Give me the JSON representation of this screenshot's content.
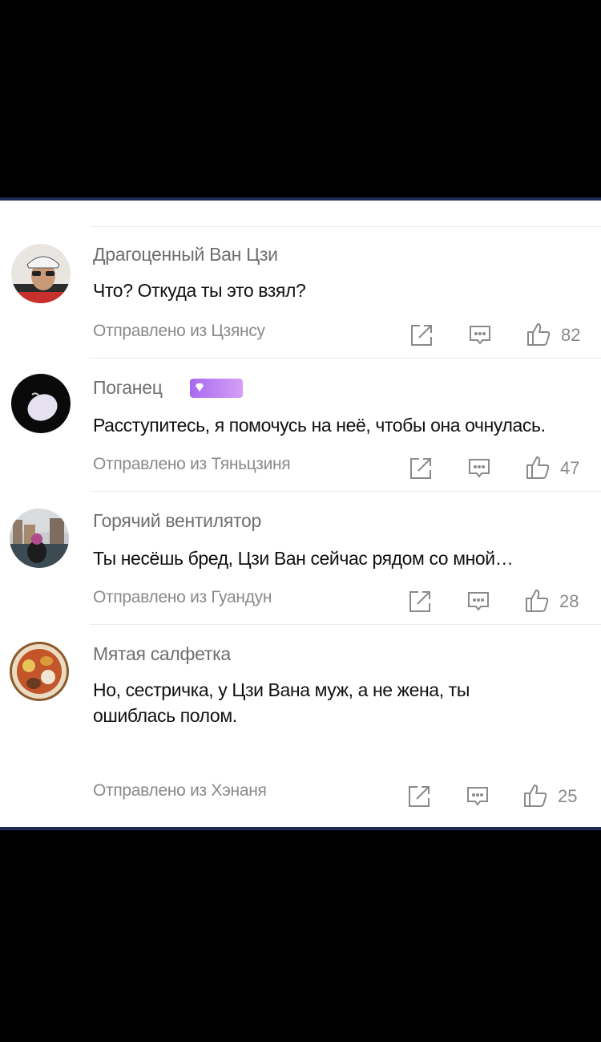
{
  "comments": [
    {
      "username": "Драгоценный Ван Цзи",
      "text": "Что? Откуда ты это взял?",
      "source": "Отправлено из Цзянсу",
      "likes": "82",
      "avatar": "cyclist-helmet-photo",
      "vip": false
    },
    {
      "username": "Поганец",
      "text": "Расступитесь, я помочусь на неё, чтобы она очнулась.",
      "source": "Отправлено из Тяньцзиня",
      "likes": "47",
      "avatar": "white-egg-on-black",
      "vip": true
    },
    {
      "username": "Горячий вентилятор",
      "text": "Ты несёшь бред, Цзи Ван сейчас рядом со мной…",
      "source": "Отправлено из Гуандун",
      "likes": "28",
      "avatar": "city-canal-photo",
      "vip": false
    },
    {
      "username": "Мятая салфетка",
      "text": "Но, сестричка, у Цзи Вана муж, а не жена, ты ошиблась полом.",
      "source": "Отправлено из Хэнаня",
      "likes": "25",
      "avatar": "food-plate-photo",
      "vip": false
    }
  ],
  "icons": {
    "share": "share-icon",
    "reply": "comment-icon",
    "like": "thumbs-up-icon"
  },
  "colors": {
    "panel_border": "#1d2b52",
    "vip_badge": "#b77cf2"
  }
}
